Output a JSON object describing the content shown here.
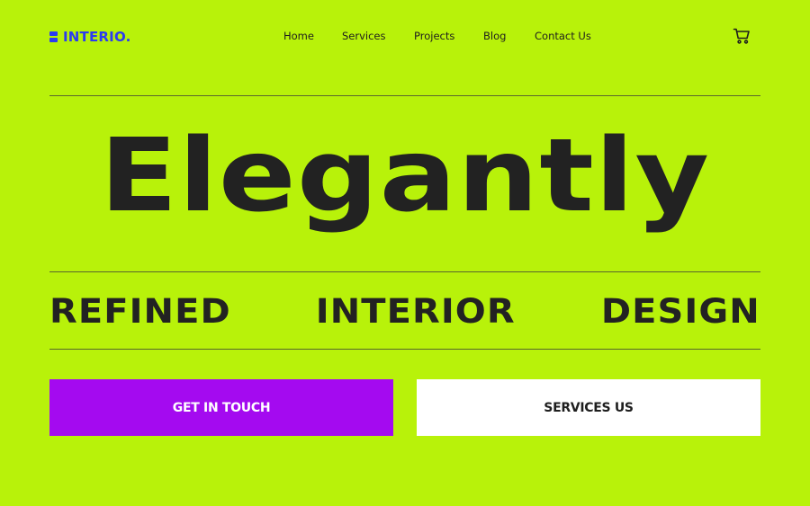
{
  "brand": {
    "name": "INTERIO.",
    "color": "#2b3bf0"
  },
  "nav": {
    "items": [
      {
        "label": "Home"
      },
      {
        "label": "Services"
      },
      {
        "label": "Projects"
      },
      {
        "label": "Blog"
      },
      {
        "label": "Contact Us"
      }
    ]
  },
  "header": {
    "cart_icon": "shopping-cart-icon"
  },
  "hero": {
    "headline": "Elegantly",
    "subheadline_words": [
      "REFINED",
      "INTERIOR",
      "DESIGN"
    ]
  },
  "actions": {
    "primary_label": "GET IN TOUCH",
    "secondary_label": "SERVICES US"
  },
  "colors": {
    "background": "#b8f20a",
    "primary_button": "#a40af0",
    "secondary_button": "#ffffff",
    "text": "#222222"
  }
}
